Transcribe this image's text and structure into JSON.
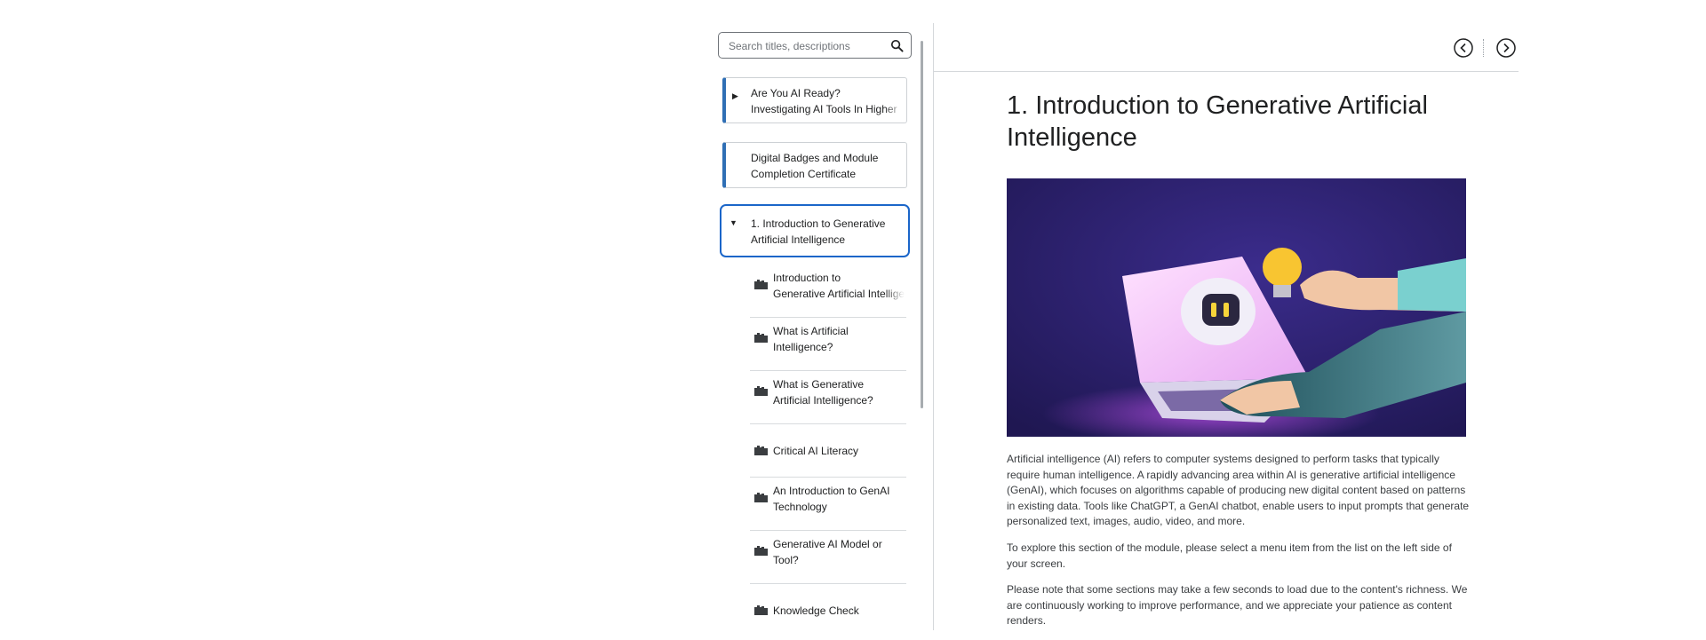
{
  "search": {
    "placeholder": "Search titles, descriptions"
  },
  "nav": {
    "cards": [
      {
        "label_line1": "Are You AI Ready?",
        "label_line2": "Investigating AI Tools In Higher",
        "caret": "▶"
      },
      {
        "label_line1": "Digital Badges and Module",
        "label_line2": "Completion Certificate"
      },
      {
        "label_line1": "1. Introduction to Generative",
        "label_line2": "Artificial Intelligence",
        "caret": "▼",
        "selected": true
      }
    ],
    "items": [
      {
        "line1": "Introduction to",
        "line2": "Generative Artificial Intelligence"
      },
      {
        "line1": "What is Artificial",
        "line2": "Intelligence?"
      },
      {
        "line1": "What is Generative",
        "line2": "Artificial Intelligence?"
      },
      {
        "line1": "Critical AI Literacy"
      },
      {
        "line1": "An Introduction to GenAI",
        "line2": "Technology"
      },
      {
        "line1": "Generative AI Model or",
        "line2": "Tool?"
      },
      {
        "line1": "Knowledge Check"
      }
    ],
    "item_icon": "book-stack-icon"
  },
  "toolbar": {
    "prev_icon": "chevron-left-circle-icon",
    "next_icon": "chevron-right-circle-icon"
  },
  "content": {
    "title": "1. Introduction to Generative Artificial Intelligence",
    "paragraphs": [
      "Artificial intelligence (AI) refers to computer systems designed to perform tasks that typically require human intelligence. A rapidly advancing area within AI is generative artificial intelligence (GenAI), which focuses on algorithms capable of producing new digital content based on patterns in existing data. Tools like ChatGPT, a GenAI chatbot, enable users to input prompts that generate personalized text, images, audio, video, and more.",
      "To explore this section of the module, please select a menu item from the list on the left side of your screen.",
      "Please note that some sections may take a few seconds to load due to the content's richness. We are continuously working to improve performance, and we appreciate your patience as content renders."
    ]
  },
  "colors": {
    "accent": "#2f6fb5",
    "selected_border": "#1b66c9",
    "hero_bg": "#2a1f6b"
  }
}
